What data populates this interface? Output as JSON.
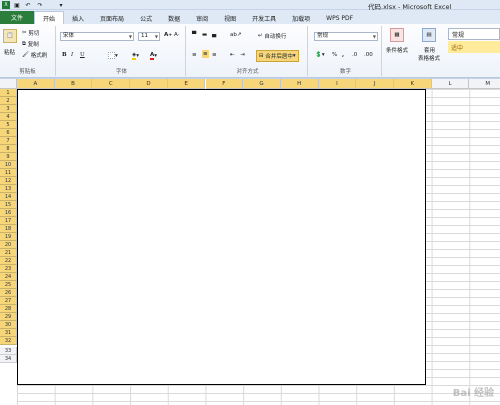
{
  "window": {
    "title": "代码.xlsx - Microsoft Excel"
  },
  "tabs": [
    "文件",
    "开始",
    "插入",
    "页面布局",
    "公式",
    "数据",
    "审阅",
    "视图",
    "开发工具",
    "加载项",
    "WPS PDF"
  ],
  "clipboard": {
    "paste": "粘贴",
    "cut": "剪切",
    "copy": "复制",
    "painter": "格式刷",
    "caption": "剪贴板"
  },
  "font": {
    "name": "宋体",
    "size": "11",
    "caption": "字体",
    "bold": "B",
    "italic": "I",
    "underline": "U",
    "font_color": "A"
  },
  "alignment": {
    "wrap": "自动换行",
    "merge": "合并后居中",
    "caption": "对齐方式"
  },
  "number": {
    "format": "常规",
    "caption": "数字",
    "percent": "%",
    "comma": ","
  },
  "styles": {
    "conditional": "条件格式",
    "table": "套用",
    "table2": "表格格式",
    "style_normal": "常规",
    "style_neutral": "适中"
  },
  "columns": [
    "A",
    "B",
    "C",
    "D",
    "E",
    "F",
    "G",
    "H",
    "I",
    "J",
    "K",
    "L",
    "M"
  ],
  "rows": [
    "1",
    "2",
    "3",
    "4",
    "5",
    "6",
    "7",
    "8",
    "9",
    "10",
    "11",
    "12",
    "13",
    "14",
    "15",
    "16",
    "17",
    "18",
    "19",
    "20",
    "21",
    "22",
    "23",
    "24",
    "25",
    "26",
    "27",
    "28",
    "29",
    "30",
    "31",
    "32",
    "33",
    "34"
  ],
  "colors": {
    "selected_header": "#f7d67a",
    "file_tab": "#2a7d3a"
  }
}
